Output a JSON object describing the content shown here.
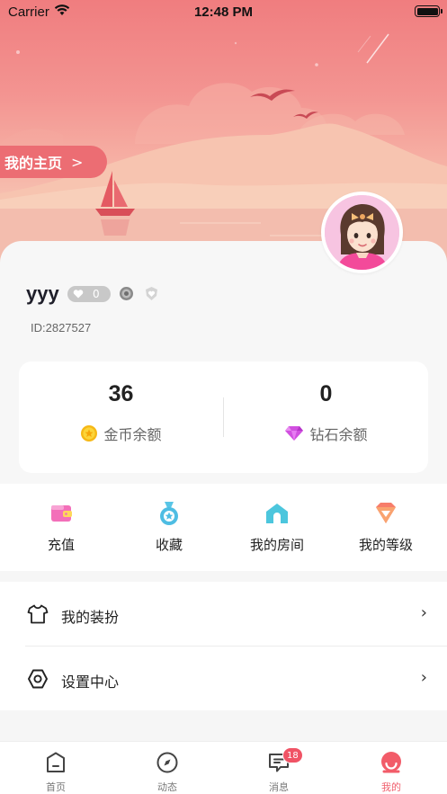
{
  "status_bar": {
    "carrier": "Carrier",
    "time": "12:48 PM"
  },
  "header": {
    "home_link_label": "我的主页"
  },
  "profile": {
    "username": "yyy",
    "level_value": "0",
    "user_id": "ID:2827527"
  },
  "balances": [
    {
      "amount": "36",
      "label": "金币余额",
      "icon": "gold-coin-icon"
    },
    {
      "amount": "0",
      "label": "钻石余额",
      "icon": "diamond-icon"
    }
  ],
  "quick_actions": [
    {
      "label": "充值",
      "icon": "wallet-icon"
    },
    {
      "label": "收藏",
      "icon": "medal-icon"
    },
    {
      "label": "我的房间",
      "icon": "house-icon"
    },
    {
      "label": "我的等级",
      "icon": "rank-badge-icon"
    }
  ],
  "menu": [
    {
      "label": "我的装扮",
      "icon": "tshirt-icon"
    },
    {
      "label": "设置中心",
      "icon": "settings-icon"
    }
  ],
  "tabs": [
    {
      "label": "首页",
      "icon": "home-tab-icon"
    },
    {
      "label": "动态",
      "icon": "compass-icon"
    },
    {
      "label": "消息",
      "icon": "message-icon",
      "badge": "18"
    },
    {
      "label": "我的",
      "icon": "profile-tab-icon",
      "active": true
    }
  ],
  "colors": {
    "accent": "#f0606e",
    "banner_top": "#f07d7f",
    "banner_bottom": "#f7c5b4",
    "home_pill": "#ec6d73"
  }
}
